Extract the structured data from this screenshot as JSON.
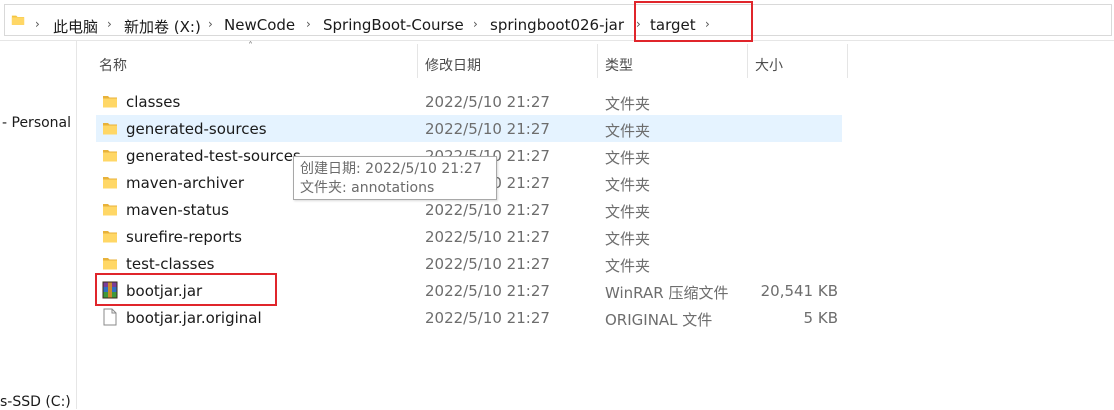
{
  "breadcrumb": [
    {
      "label": "此电脑"
    },
    {
      "label": "新加卷 (X:)"
    },
    {
      "label": "NewCode"
    },
    {
      "label": "SpringBoot-Course"
    },
    {
      "label": "springboot026-jar"
    },
    {
      "label": "target"
    }
  ],
  "nav": {
    "items": [
      {
        "label": "- Personal"
      },
      {
        "label": "s-SSD (C:)"
      }
    ]
  },
  "columns": {
    "name": "名称",
    "date": "修改日期",
    "type": "类型",
    "size": "大小"
  },
  "files": [
    {
      "name": "classes",
      "date": "2022/5/10 21:27",
      "type": "文件夹",
      "size": "",
      "icon": "folder-icon"
    },
    {
      "name": "generated-sources",
      "date": "2022/5/10 21:27",
      "type": "文件夹",
      "size": "",
      "icon": "folder-icon"
    },
    {
      "name": "generated-test-sources",
      "date": "2022/5/10 21:27",
      "type": "文件夹",
      "size": "",
      "icon": "folder-icon"
    },
    {
      "name": "maven-archiver",
      "date": "2022/5/10 21:27",
      "type": "文件夹",
      "size": "",
      "icon": "folder-icon"
    },
    {
      "name": "maven-status",
      "date": "2022/5/10 21:27",
      "type": "文件夹",
      "size": "",
      "icon": "folder-icon"
    },
    {
      "name": "surefire-reports",
      "date": "2022/5/10 21:27",
      "type": "文件夹",
      "size": "",
      "icon": "folder-icon"
    },
    {
      "name": "test-classes",
      "date": "2022/5/10 21:27",
      "type": "文件夹",
      "size": "",
      "icon": "folder-icon"
    },
    {
      "name": "bootjar.jar",
      "date": "2022/5/10 21:27",
      "type": "WinRAR 压缩文件",
      "size": "20,541 KB",
      "icon": "winrar-archive-icon"
    },
    {
      "name": "bootjar.jar.original",
      "date": "2022/5/10 21:27",
      "type": "ORIGINAL 文件",
      "size": "5 KB",
      "icon": "generic-file-icon"
    }
  ],
  "tooltip": {
    "line1": "创建日期: 2022/5/10 21:27",
    "line2": "文件夹: annotations"
  },
  "colors": {
    "highlight": "#e0252b",
    "selection": "#e5f3ff",
    "folder": "#f4c542"
  }
}
